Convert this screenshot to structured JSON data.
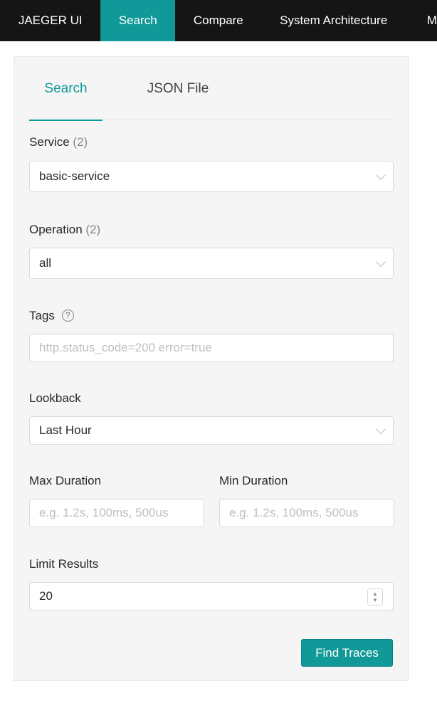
{
  "nav": {
    "brand": "JAEGER UI",
    "items": [
      {
        "label": "Search",
        "active": true
      },
      {
        "label": "Compare"
      },
      {
        "label": "System Architecture"
      },
      {
        "label": "M"
      }
    ]
  },
  "tabs": [
    {
      "label": "Search",
      "active": true
    },
    {
      "label": "JSON File"
    }
  ],
  "form": {
    "service": {
      "label": "Service",
      "count": "(2)",
      "value": "basic-service"
    },
    "operation": {
      "label": "Operation",
      "count": "(2)",
      "value": "all"
    },
    "tags": {
      "label": "Tags",
      "help": "?",
      "placeholder": "http.status_code=200 error=true"
    },
    "lookback": {
      "label": "Lookback",
      "value": "Last Hour"
    },
    "max_duration": {
      "label": "Max Duration",
      "placeholder": "e.g. 1.2s, 100ms, 500us"
    },
    "min_duration": {
      "label": "Min Duration",
      "placeholder": "e.g. 1.2s, 100ms, 500us"
    },
    "limit": {
      "label": "Limit Results",
      "value": "20"
    },
    "submit": "Find Traces"
  },
  "colors": {
    "accent": "#119999",
    "nav_bg": "#151515"
  }
}
